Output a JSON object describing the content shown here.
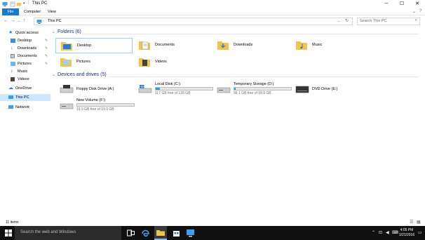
{
  "window": {
    "title": "This PC",
    "controls": {
      "minimize": "─",
      "maximize": "☐",
      "close": "✕"
    }
  },
  "ribbon": {
    "tabs": [
      {
        "label": "File"
      },
      {
        "label": "Computer"
      },
      {
        "label": "View"
      }
    ],
    "accent": "#1979ca"
  },
  "address": {
    "path": "This PC",
    "search_placeholder": "Search This PC"
  },
  "nav": {
    "items": [
      {
        "label": "Quick access",
        "icon": "star-icon",
        "pinned": false
      },
      {
        "label": "Desktop",
        "icon": "desktop-icon",
        "pinned": true
      },
      {
        "label": "Downloads",
        "icon": "download-icon",
        "pinned": true
      },
      {
        "label": "Documents",
        "icon": "documents-icon",
        "pinned": true
      },
      {
        "label": "Pictures",
        "icon": "pictures-icon",
        "pinned": true
      },
      {
        "label": "Music",
        "icon": "music-icon",
        "pinned": false
      },
      {
        "label": "Videos",
        "icon": "videos-icon",
        "pinned": false
      },
      {
        "label": "OneDrive",
        "icon": "cloud-icon",
        "pinned": false
      },
      {
        "label": "This PC",
        "icon": "computer-icon",
        "pinned": false,
        "selected": true
      },
      {
        "label": "Network",
        "icon": "network-icon",
        "pinned": false
      }
    ],
    "pin_glyph": "✎"
  },
  "content": {
    "folders_header": "Folders (6)",
    "folders": [
      {
        "label": "Desktop"
      },
      {
        "label": "Documents"
      },
      {
        "label": "Downloads"
      },
      {
        "label": "Music"
      },
      {
        "label": "Pictures"
      },
      {
        "label": "Videos"
      }
    ],
    "drives_header": "Devices and drives (5)",
    "drives": [
      {
        "label": "Floppy Disk Drive (A:)",
        "free": "",
        "used_fraction": null
      },
      {
        "label": "Local Disk (C:)",
        "free": "117 GB free of 126 GB",
        "used_fraction": 0.07
      },
      {
        "label": "Temporary Storage (D:)",
        "free": "98.1 GB free of 99.9 GB",
        "used_fraction": 0.02
      },
      {
        "label": "DVD Drive (E:)",
        "free": "",
        "used_fraction": null
      },
      {
        "label": "New Volume (F:)",
        "free": "19.9 GB free of 19.9 GB",
        "used_fraction": 0.0
      }
    ]
  },
  "status": {
    "items_count": "11 items"
  },
  "taskbar": {
    "search_placeholder": "Search the web and Windows",
    "time": "4:05 PM",
    "date": "1/21/2016"
  }
}
